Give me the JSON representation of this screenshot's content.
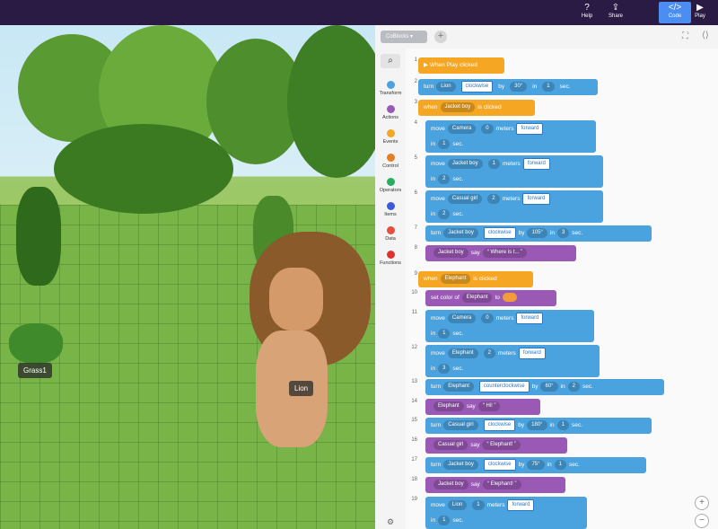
{
  "topbar": {
    "help_label": "Help",
    "share_label": "Share",
    "code_label": "Code",
    "play_label": "Play"
  },
  "scene": {
    "label_grass": "Grass1",
    "label_lion": "Lion"
  },
  "panel": {
    "tab_label": "CoBlocks",
    "add_tab": "+"
  },
  "sidebar": {
    "items": [
      {
        "label": "Transform",
        "color": "#4aa3df"
      },
      {
        "label": "Actions",
        "color": "#9b59b6"
      },
      {
        "label": "Events",
        "color": "#f5a623"
      },
      {
        "label": "Control",
        "color": "#e67e22"
      },
      {
        "label": "Operators",
        "color": "#27ae60"
      },
      {
        "label": "Items",
        "color": "#3b5bdb"
      },
      {
        "label": "Data",
        "color": "#e74c3c"
      },
      {
        "label": "Functions",
        "color": "#e03131"
      }
    ]
  },
  "code": {
    "lines": [
      "1",
      "2",
      "3",
      "4",
      "5",
      "6",
      "7",
      "8",
      "9",
      "10",
      "11",
      "12",
      "13",
      "14",
      "15",
      "16",
      "17",
      "18",
      "19"
    ],
    "b1": "▶ When Play clicked",
    "b2": {
      "turn": "turn",
      "obj": "Lion",
      "dir": "clockwise",
      "by": "by",
      "deg": "30°",
      "in": "in",
      "t": "1",
      "sec": "sec."
    },
    "b3": {
      "when": "when",
      "obj": "Jacket boy",
      "clicked": "is clicked"
    },
    "b4": {
      "move": "move",
      "obj": "Camera",
      "n": "0",
      "meters": "meters",
      "dir": "forward",
      "in": "in",
      "t": "1",
      "sec": "sec."
    },
    "b5": {
      "move": "move",
      "obj": "Jacket boy",
      "n": "1",
      "meters": "meters",
      "dir": "forward",
      "in": "in",
      "t": "2",
      "sec": "sec."
    },
    "b6": {
      "move": "move",
      "obj": "Casual girl",
      "n": "2",
      "meters": "meters",
      "dir": "forward",
      "in": "in",
      "t": "2",
      "sec": "sec."
    },
    "b7": {
      "turn": "turn",
      "obj": "Jacket boy",
      "dir": "clockwise",
      "by": "by",
      "deg": "105°",
      "in": "in",
      "t": "3",
      "sec": "sec."
    },
    "b8": {
      "obj": "Jacket boy",
      "say": "say",
      "text": "“ Where is t... ”"
    },
    "b9": {
      "when": "when",
      "obj": "Elephant",
      "clicked": "is clicked"
    },
    "b10": {
      "set": "set color of",
      "obj": "Elephant",
      "to": "to",
      "color": "#f39c3c"
    },
    "b11": {
      "move": "move",
      "obj": "Camera",
      "n": "0",
      "meters": "meters",
      "dir": "forward",
      "in": "in",
      "t": "1",
      "sec": "sec."
    },
    "b12": {
      "move": "move",
      "obj": "Elephant",
      "n": "2",
      "meters": "meters",
      "dir": "forward",
      "in": "in",
      "t": "3",
      "sec": "sec."
    },
    "b13": {
      "turn": "turn",
      "obj": "Elephant",
      "dir": "counterclockwise",
      "by": "by",
      "deg": "60°",
      "in": "in",
      "t": "2",
      "sec": "sec."
    },
    "b14": {
      "obj": "Elephant",
      "say": "say",
      "text": "“ Hi! ”"
    },
    "b15": {
      "turn": "turn",
      "obj": "Casual girl",
      "dir": "clockwise",
      "by": "by",
      "deg": "180°",
      "in": "in",
      "t": "1",
      "sec": "sec."
    },
    "b16": {
      "obj": "Casual girl",
      "say": "say",
      "text": "“ Elephant! ”"
    },
    "b17": {
      "turn": "turn",
      "obj": "Jacket boy",
      "dir": "clockwise",
      "by": "by",
      "deg": "75°",
      "in": "in",
      "t": "1",
      "sec": "sec."
    },
    "b18": {
      "obj": "Jacket boy",
      "say": "say",
      "text": "“ Elephant! ”"
    },
    "b19": {
      "move": "move",
      "obj": "Lion",
      "n": "1",
      "meters": "meters",
      "dir": "forward",
      "in": "in",
      "t": "1",
      "sec": "sec."
    }
  },
  "zoom": {
    "in": "+",
    "out": "−"
  }
}
